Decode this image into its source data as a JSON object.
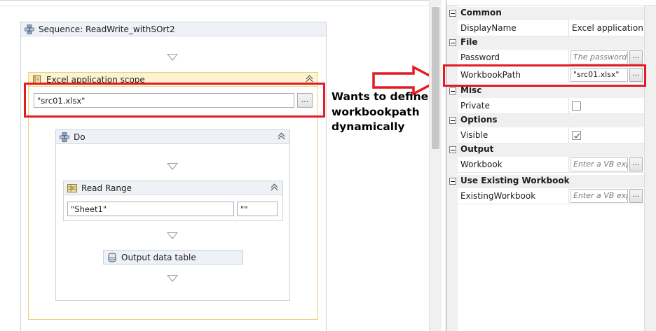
{
  "designer": {
    "sequence_title": "Sequence: ReadWrite_withSOrt2",
    "scope_title": "Excel application scope",
    "scope_path_value": "\"src01.xlsx\"",
    "scope_browse_label": "...",
    "do_title": "Do",
    "read_range_title": "Read Range",
    "sheet_value": "\"Sheet1\"",
    "range_value": "\"\"",
    "output_title": "Output data table"
  },
  "annotation": {
    "line1": "Wants to define",
    "line2": "workbookpath",
    "line3": "dynamically",
    "highlight_color": "#e41b23"
  },
  "properties": {
    "categories": [
      {
        "title": "Common",
        "rows": [
          {
            "name": "DisplayName",
            "value": "Excel application sc"
          }
        ]
      },
      {
        "title": "File",
        "rows": [
          {
            "name": "Password",
            "placeholder": "The password",
            "button": "..."
          },
          {
            "name": "WorkbookPath",
            "value": "\"src01.xlsx\"",
            "button": "..."
          }
        ]
      },
      {
        "title": "Misc",
        "rows": [
          {
            "name": "Private",
            "checked": false
          }
        ]
      },
      {
        "title": "Options",
        "rows": [
          {
            "name": "Visible",
            "checked": true
          }
        ]
      },
      {
        "title": "Output",
        "rows": [
          {
            "name": "Workbook",
            "placeholder": "Enter a VB exp",
            "button": "..."
          }
        ]
      },
      {
        "title": "Use Existing Workbook",
        "rows": [
          {
            "name": "ExistingWorkbook",
            "placeholder": "Enter a VB exp",
            "button": "..."
          }
        ]
      }
    ]
  }
}
